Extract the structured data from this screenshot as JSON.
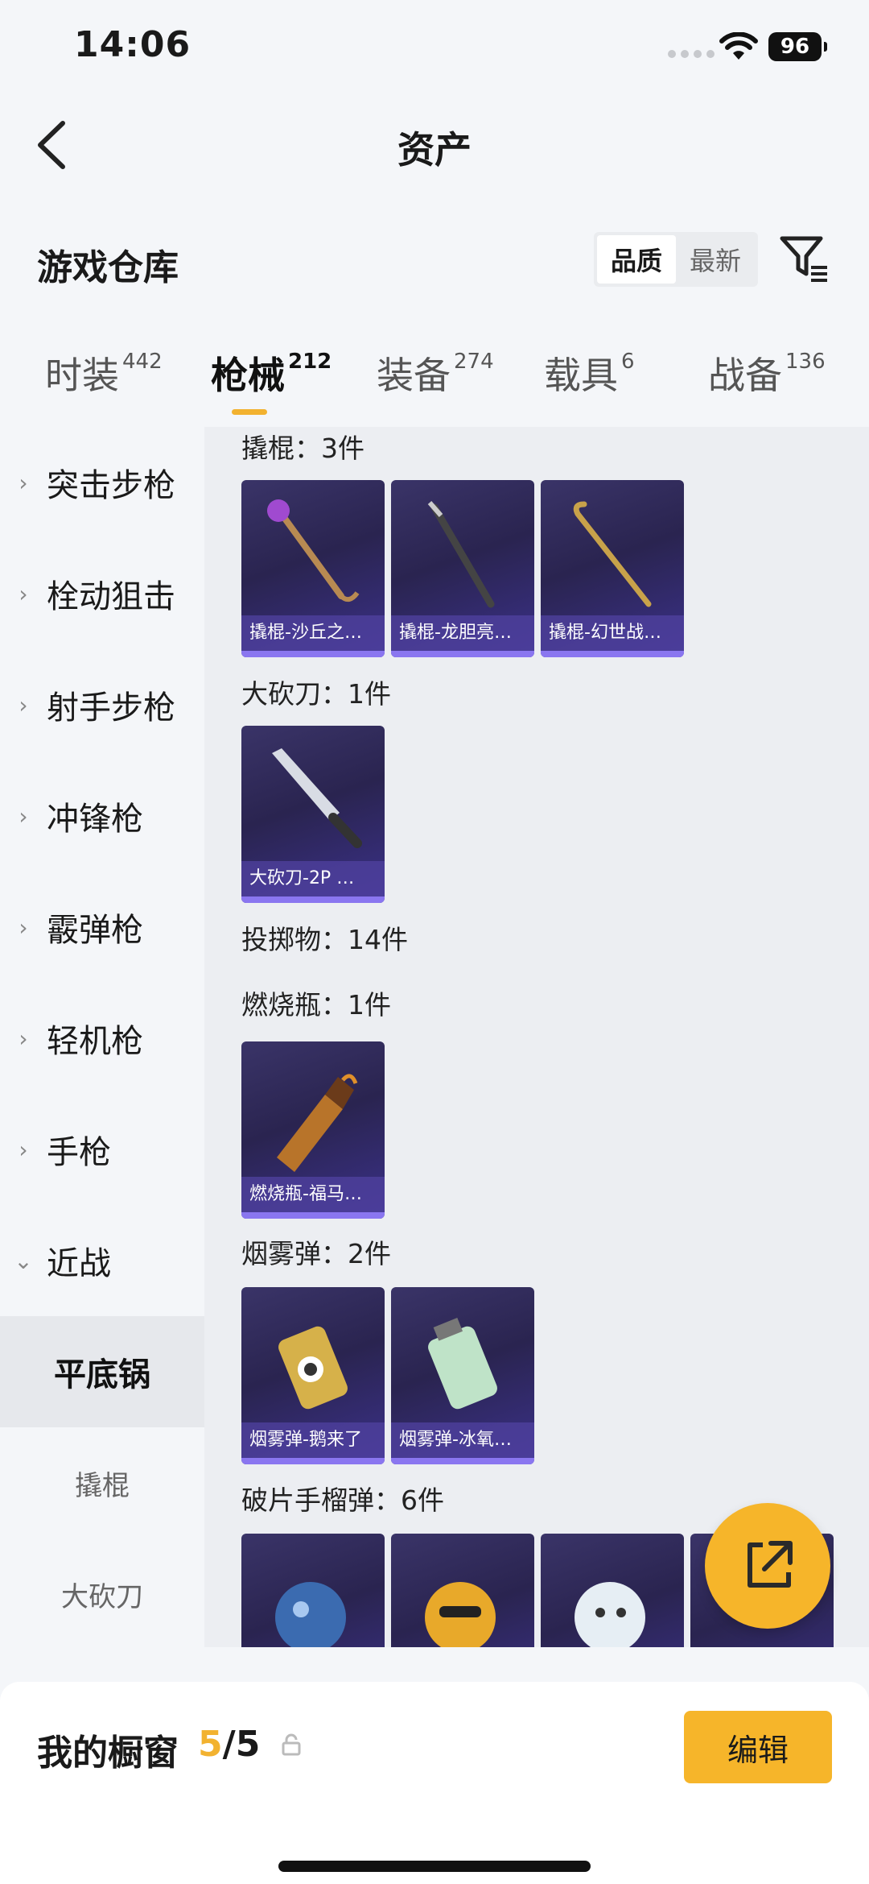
{
  "status_bar": {
    "time": "14:06",
    "battery": "96"
  },
  "header": {
    "title": "资产"
  },
  "warehouse": {
    "title": "游戏仓库",
    "sort_options": [
      "品质",
      "最新"
    ]
  },
  "tabs": [
    {
      "label": "时装",
      "count": "442"
    },
    {
      "label": "枪械",
      "count": "212"
    },
    {
      "label": "装备",
      "count": "274"
    },
    {
      "label": "载具",
      "count": "6"
    },
    {
      "label": "战备",
      "count": "136"
    }
  ],
  "sidebar": {
    "categories": [
      "突击步枪",
      "栓动狙击",
      "射手步枪",
      "冲锋枪",
      "霰弹枪",
      "轻机枪",
      "手枪",
      "近战"
    ],
    "subcategories": [
      "平底锅",
      "撬棍",
      "大砍刀"
    ]
  },
  "content": {
    "groups": [
      {
        "label": "撬棍：3件",
        "items": [
          "撬棍-沙丘之…",
          "撬棍-龙胆亮…",
          "撬棍-幻世战…"
        ]
      },
      {
        "label": "大砍刀：1件",
        "items": [
          "大砍刀-2P …"
        ]
      },
      {
        "label": "投掷物：14件",
        "items": []
      },
      {
        "label": "燃烧瓶：1件",
        "items": [
          "燃烧瓶-福马…"
        ]
      },
      {
        "label": "烟雾弹：2件",
        "items": [
          "烟雾弹-鹅来了",
          "烟雾弹-冰氧…"
        ]
      },
      {
        "label": "破片手榴弹：6件",
        "items": []
      }
    ]
  },
  "showcase": {
    "title": "我的橱窗",
    "current": "5",
    "total": "/5",
    "edit_label": "编辑"
  },
  "colors": {
    "accent": "#f2b230",
    "card": "#2a2450"
  }
}
